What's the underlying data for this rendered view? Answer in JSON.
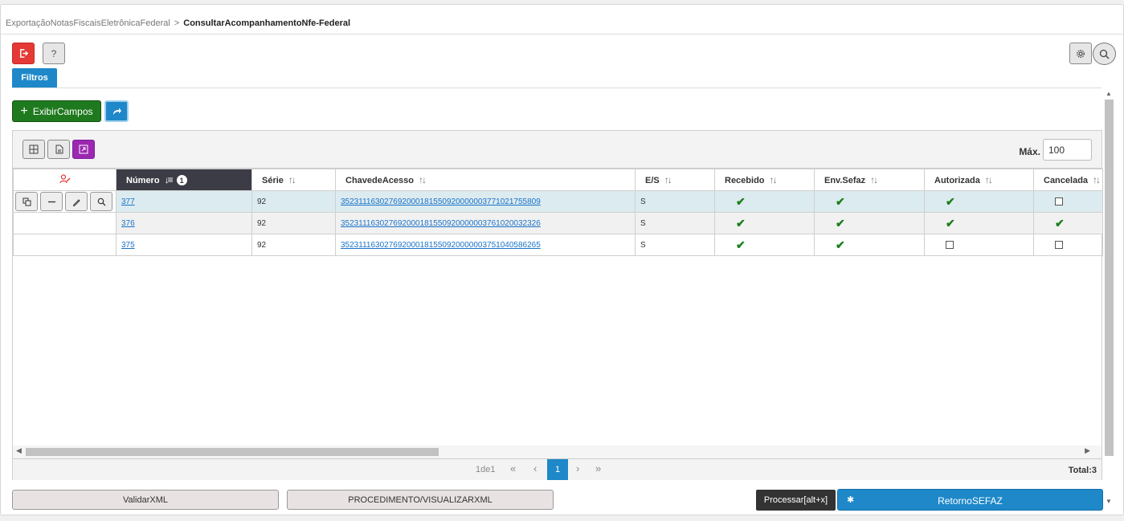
{
  "breadcrumb": {
    "parent": "Exportação Notas Fiscais Eletrônica Federal",
    "separator": ">",
    "current": "Consultar Acompanhamento Nfe - Federal"
  },
  "header": {
    "help_label": "?"
  },
  "tabs": [
    {
      "label": "Filtros",
      "active": true
    }
  ],
  "toolbar": {
    "exibir_campos_label": "Exibir Campos"
  },
  "grid": {
    "max_label": "Máx.",
    "max_value": "100",
    "columns": [
      {
        "label": "Número",
        "sort_badge": "1",
        "sorted": true
      },
      {
        "label": "Série"
      },
      {
        "label": "Chave de Acesso"
      },
      {
        "label": "E/S"
      },
      {
        "label": "Recebido"
      },
      {
        "label": "Env. Sefaz"
      },
      {
        "label": "Autorizada"
      },
      {
        "label": "Cancelada"
      }
    ],
    "rows": [
      {
        "numero": "377",
        "serie": "92",
        "chave": "35231116302769200018155092000000377102175580 9",
        "es": "S",
        "recebido": true,
        "env_sefaz": true,
        "autorizada": true,
        "cancelada": false
      },
      {
        "numero": "376",
        "serie": "92",
        "chave": "35231116302769200018155092000000376102003232 6",
        "es": "S",
        "recebido": true,
        "env_sefaz": true,
        "autorizada": true,
        "cancelada": true
      },
      {
        "numero": "375",
        "serie": "92",
        "chave": "35231116302769200018155092000000375104058626 5",
        "es": "S",
        "recebido": true,
        "env_sefaz": true,
        "autorizada": false,
        "cancelada": false
      }
    ]
  },
  "pager": {
    "info": "1 de 1",
    "first": "«",
    "prev": "‹",
    "current": "1",
    "next": "›",
    "last": "»",
    "total": "Total: 3"
  },
  "buttons": {
    "validar_xml": "Validar XML",
    "procedimento": "PROCEDIMENTO / VISUALIZAR XML",
    "processar_tooltip": "Processar [alt + x]",
    "retorno_sefaz": "Retorno SEFAZ"
  },
  "colors": {
    "primary": "#1e88c9",
    "success": "#1f7a1f",
    "danger": "#e53935",
    "accent": "#9c27b0",
    "sorted_header": "#3c3c46",
    "link": "#1a73c9"
  }
}
